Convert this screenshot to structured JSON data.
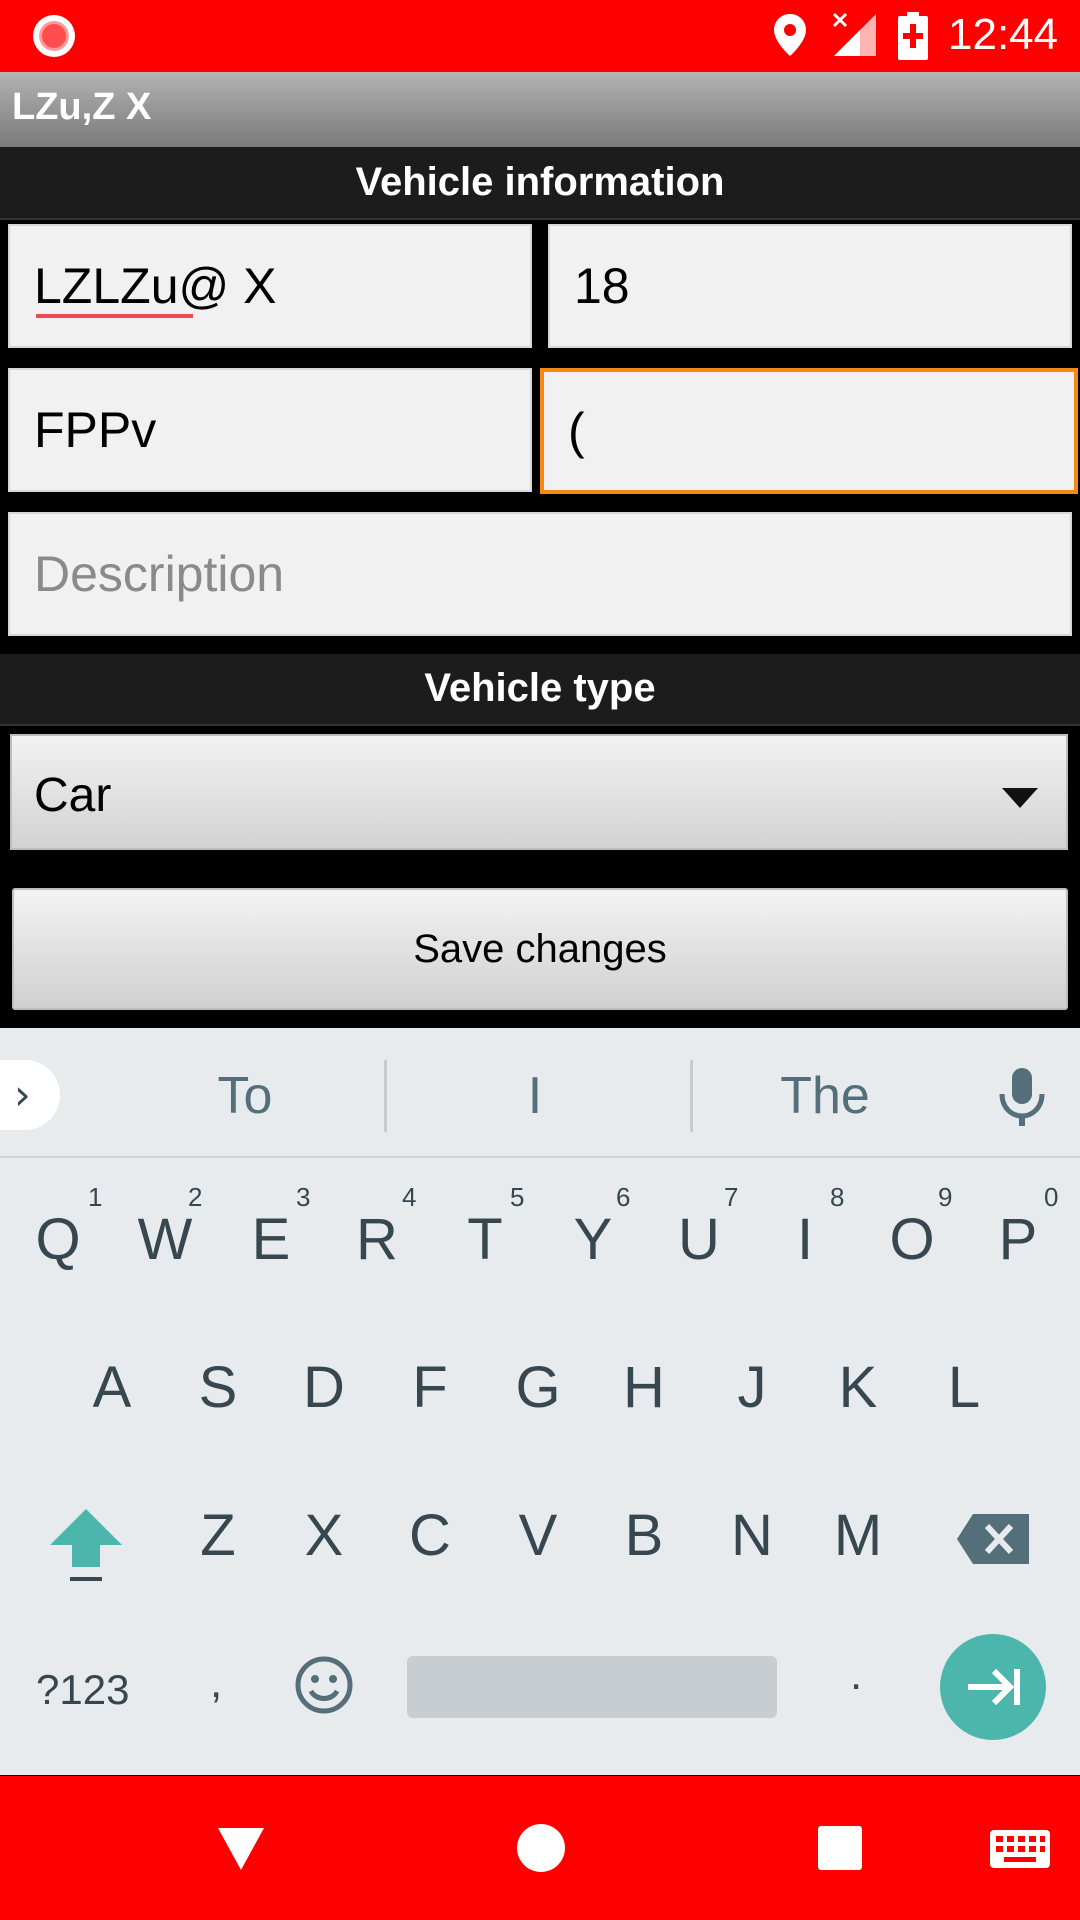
{
  "status_bar": {
    "time": "12:44",
    "icons": [
      "record-icon",
      "location-icon",
      "signal-icon",
      "battery-charging-icon"
    ]
  },
  "app": {
    "title": "LZu,Z X"
  },
  "vehicle_info": {
    "header": "Vehicle information",
    "field_1": "LZLZu@ X",
    "field_2": "18",
    "field_3": "FPPv",
    "field_4": "(",
    "description_placeholder": "Description"
  },
  "vehicle_type": {
    "header": "Vehicle type",
    "selected": "Car"
  },
  "actions": {
    "save_label": "Save changes"
  },
  "keyboard": {
    "suggestions": [
      "To",
      "I",
      "The"
    ],
    "row1": [
      "Q",
      "W",
      "E",
      "R",
      "T",
      "Y",
      "U",
      "I",
      "O",
      "P"
    ],
    "row1_hints": [
      "1",
      "2",
      "3",
      "4",
      "5",
      "6",
      "7",
      "8",
      "9",
      "0"
    ],
    "row2": [
      "A",
      "S",
      "D",
      "F",
      "G",
      "H",
      "J",
      "K",
      "L"
    ],
    "row3": [
      "Z",
      "X",
      "C",
      "V",
      "B",
      "N",
      "M"
    ],
    "symbols_label": "?123",
    "comma": ",",
    "period": ".",
    "accent_color": "#4db6ac"
  },
  "colors": {
    "status_bar": "#ff0000",
    "focus_border": "#f58a12"
  }
}
